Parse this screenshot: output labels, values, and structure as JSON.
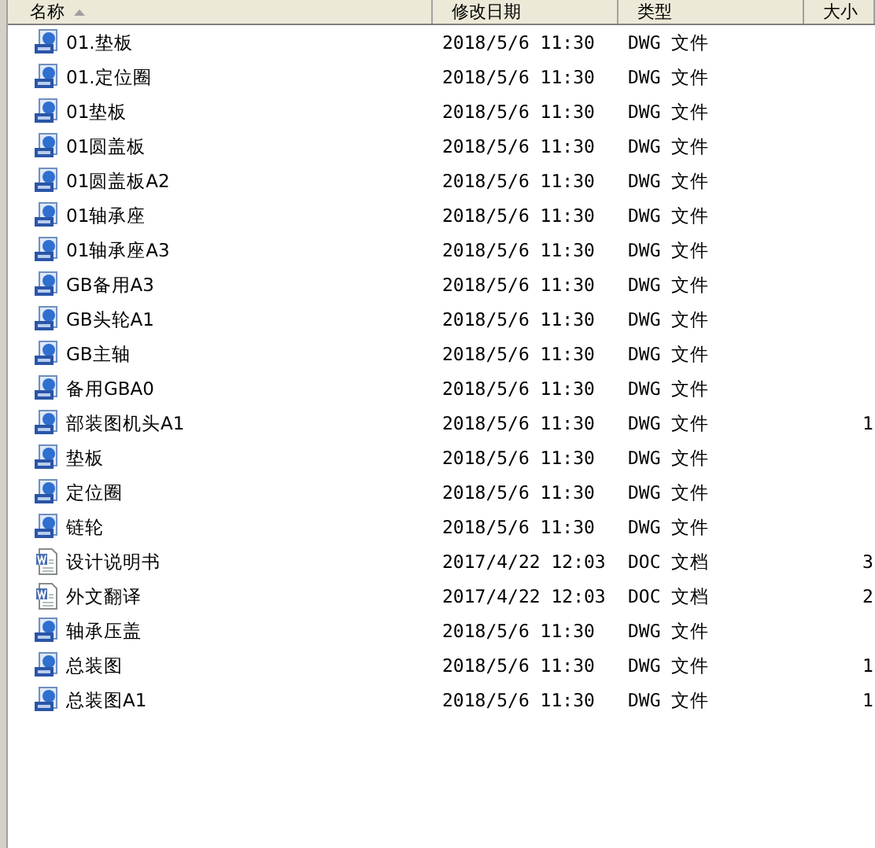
{
  "columns": [
    {
      "label": "名称",
      "sorted": true
    },
    {
      "label": "修改日期",
      "sorted": false
    },
    {
      "label": "类型",
      "sorted": false
    },
    {
      "label": "大小",
      "sorted": false
    }
  ],
  "rows": [
    {
      "kind": "dwg",
      "name": "01.垫板",
      "date": "2018/5/6 11:30",
      "type": "DWG 文件"
    },
    {
      "kind": "dwg",
      "name": "01.定位圈",
      "date": "2018/5/6 11:30",
      "type": "DWG 文件"
    },
    {
      "kind": "dwg",
      "name": "01垫板",
      "date": "2018/5/6 11:30",
      "type": "DWG 文件"
    },
    {
      "kind": "dwg",
      "name": "01圆盖板",
      "date": "2018/5/6 11:30",
      "type": "DWG 文件"
    },
    {
      "kind": "dwg",
      "name": "01圆盖板A2",
      "date": "2018/5/6 11:30",
      "type": "DWG 文件"
    },
    {
      "kind": "dwg",
      "name": "01轴承座",
      "date": "2018/5/6 11:30",
      "type": "DWG 文件"
    },
    {
      "kind": "dwg",
      "name": "01轴承座A3",
      "date": "2018/5/6 11:30",
      "type": "DWG 文件"
    },
    {
      "kind": "dwg",
      "name": "GB备用A3",
      "date": "2018/5/6 11:30",
      "type": "DWG 文件"
    },
    {
      "kind": "dwg",
      "name": "GB头轮A1",
      "date": "2018/5/6 11:30",
      "type": "DWG 文件"
    },
    {
      "kind": "dwg",
      "name": "GB主轴",
      "date": "2018/5/6 11:30",
      "type": "DWG 文件"
    },
    {
      "kind": "dwg",
      "name": "备用GBA0",
      "date": "2018/5/6 11:30",
      "type": "DWG 文件"
    },
    {
      "kind": "dwg",
      "name": "部装图机头A1",
      "date": "2018/5/6 11:30",
      "type": "DWG 文件",
      "size": "1"
    },
    {
      "kind": "dwg",
      "name": "垫板",
      "date": "2018/5/6 11:30",
      "type": "DWG 文件"
    },
    {
      "kind": "dwg",
      "name": "定位圈",
      "date": "2018/5/6 11:30",
      "type": "DWG 文件"
    },
    {
      "kind": "dwg",
      "name": "链轮",
      "date": "2018/5/6 11:30",
      "type": "DWG 文件"
    },
    {
      "kind": "doc",
      "name": "设计说明书",
      "date": "2017/4/22 12:03",
      "type": "DOC 文档",
      "size": "3"
    },
    {
      "kind": "doc",
      "name": "外文翻译",
      "date": "2017/4/22 12:03",
      "type": "DOC 文档",
      "size": "2"
    },
    {
      "kind": "dwg",
      "name": "轴承压盖",
      "date": "2018/5/6 11:30",
      "type": "DWG 文件"
    },
    {
      "kind": "dwg",
      "name": "总装图",
      "date": "2018/5/6 11:30",
      "type": "DWG 文件",
      "size": "1"
    },
    {
      "kind": "dwg",
      "name": "总装图A1",
      "date": "2018/5/6 11:30",
      "type": "DWG 文件",
      "size": "1"
    }
  ]
}
